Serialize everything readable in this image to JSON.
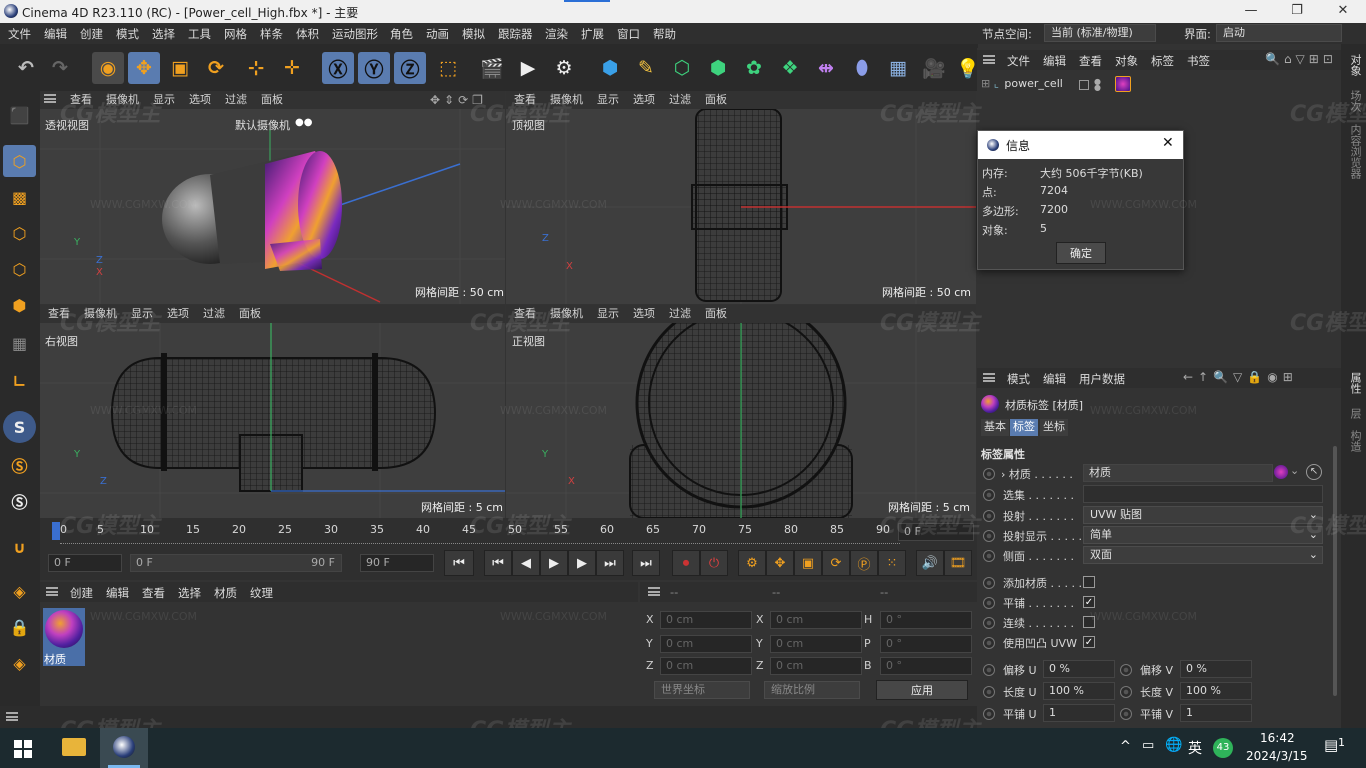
{
  "window": {
    "title": "Cinema 4D R23.110 (RC) - [Power_cell_High.fbx *] - 主要",
    "minimize": "—",
    "maximize": "❐",
    "close": "✕"
  },
  "menubar": [
    "文件",
    "编辑",
    "创建",
    "模式",
    "选择",
    "工具",
    "网格",
    "样条",
    "体积",
    "运动图形",
    "角色",
    "动画",
    "模拟",
    "跟踪器",
    "渲染",
    "扩展",
    "窗口",
    "帮助"
  ],
  "node_space": {
    "label": "节点空间:",
    "value": "当前 (标准/物理)"
  },
  "layout": {
    "label": "界面:",
    "value": "启动"
  },
  "viewport_menu": [
    "查看",
    "摄像机",
    "显示",
    "选项",
    "过滤",
    "面板"
  ],
  "viewports": [
    {
      "name": "透视视图",
      "camera": "默认摄像机",
      "grid": "网格间距 : 50 cm"
    },
    {
      "name": "顶视图",
      "grid": "网格间距 : 50 cm"
    },
    {
      "name": "右视图",
      "grid": "网格间距 : 5 cm"
    },
    {
      "name": "正视图",
      "grid": "网格间距 : 5 cm"
    }
  ],
  "axis": {
    "x": "X",
    "y": "Y",
    "z": "Z"
  },
  "timeline": {
    "ticks": [
      "0",
      "5",
      "10",
      "15",
      "20",
      "25",
      "30",
      "35",
      "40",
      "45",
      "50",
      "55",
      "60",
      "65",
      "70",
      "75",
      "80",
      "85",
      "90"
    ],
    "current": "0 F",
    "start": "0 F",
    "range_start": "0 F",
    "range_end": "90 F",
    "end": "90 F",
    "right_frame": "0 F"
  },
  "material_manager": {
    "menu": [
      "创建",
      "编辑",
      "查看",
      "选择",
      "材质",
      "纹理"
    ],
    "material_name": "材质"
  },
  "coords": {
    "headers": [
      "--",
      "--",
      "--"
    ],
    "rows": [
      {
        "a": "X",
        "av": "0 cm",
        "b": "X",
        "bv": "0 cm",
        "c": "H",
        "cv": "0 °"
      },
      {
        "a": "Y",
        "av": "0 cm",
        "b": "Y",
        "bv": "0 cm",
        "c": "P",
        "cv": "0 °"
      },
      {
        "a": "Z",
        "av": "0 cm",
        "b": "Z",
        "bv": "0 cm",
        "c": "B",
        "cv": "0 °"
      }
    ],
    "world": "世界坐标",
    "scale": "缩放比例",
    "apply": "应用"
  },
  "object_manager": {
    "menu": [
      "文件",
      "编辑",
      "查看",
      "对象",
      "标签",
      "书签"
    ],
    "object": "power_cell"
  },
  "right_tabs": [
    "对象",
    "场次",
    "内容浏览器",
    "属性",
    "层",
    "构造"
  ],
  "info_dialog": {
    "title": "信息",
    "rows": [
      {
        "k": "内存:",
        "v": "大约 506千字节(KB)"
      },
      {
        "k": "点:",
        "v": "7204"
      },
      {
        "k": "多边形:",
        "v": "7200"
      },
      {
        "k": "对象:",
        "v": "5"
      }
    ],
    "ok": "确定"
  },
  "attributes": {
    "menu": [
      "模式",
      "编辑",
      "用户数据"
    ],
    "title": "材质标签 [材质]",
    "tabs": [
      "基本",
      "标签",
      "坐标"
    ],
    "section": "标签属性",
    "material_label": "材质 . . . . . .",
    "material_value": "材质",
    "selection_label": "选集 . . . . . . .",
    "projection_label": "投射 . . . . . . .",
    "projection_value": "UVW 贴图",
    "projdisplay_label": "投射显示 . . . . .",
    "projdisplay_value": "简单",
    "side_label": "侧面 . . . . . . .",
    "side_value": "双面",
    "add_label": "添加材质 . . . . .",
    "tile_label": "平铺 . . . . . . .",
    "seamless_label": "连续 . . . . . . .",
    "bump_label": "使用凹凸 UVW",
    "offset_u": "偏移 U",
    "offset_u_v": "0 %",
    "offset_v": "偏移 V",
    "offset_v_v": "0 %",
    "length_u": "长度 U",
    "length_u_v": "100 %",
    "length_v": "长度 V",
    "length_v_v": "100 %",
    "tiles_u": "平铺 U",
    "tiles_u_v": "1",
    "tiles_v": "平铺 V",
    "tiles_v_v": "1"
  },
  "taskbar": {
    "time": "16:42",
    "date": "2024/3/15",
    "ime": "英",
    "badge": "43",
    "notif": "1"
  },
  "watermark": {
    "logo": "CG模型主",
    "url": "WWW.CGMXW.COM"
  }
}
